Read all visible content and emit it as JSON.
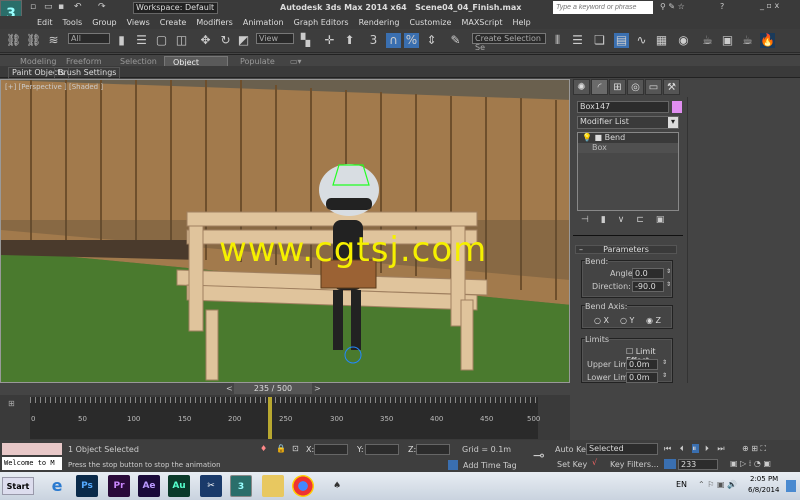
{
  "title_bar": {
    "workspace": "Workspace: Default",
    "app_title": "Autodesk 3ds Max  2014 x64",
    "file_name": "Scene04_04_Finish.max",
    "search_placeholder": "Type a keyword or phrase"
  },
  "menu": [
    "Edit",
    "Tools",
    "Group",
    "Views",
    "Create",
    "Modifiers",
    "Animation",
    "Graph Editors",
    "Rendering",
    "Customize",
    "MAXScript",
    "Help"
  ],
  "toolbar": {
    "selection_filter": "All",
    "ref_coord": "View",
    "snap_label": "3",
    "selection_set": "Create Selection Se"
  },
  "ribbon": {
    "tabs": [
      "Modeling",
      "Freeform",
      "Selection",
      "Object Paint",
      "Populate"
    ],
    "active_tab": "Object Paint",
    "sub_buttons": [
      "Paint Objects",
      "Brush Settings"
    ]
  },
  "viewport": {
    "label": "[+] [Perspective ] [Shaded ]",
    "watermark": "www.cgtsj.com"
  },
  "command_panel": {
    "object_name": "Box147",
    "object_color": "#e08ef0",
    "modifier_list": "Modifier List",
    "stack": [
      "Bend",
      "Box"
    ],
    "rollout_title": "Parameters",
    "bend_group": "Bend:",
    "angle_label": "Angle:",
    "angle": "0.0",
    "direction_label": "Direction:",
    "direction": "-90.0",
    "axis_group": "Bend Axis:",
    "axes": [
      "X",
      "Y",
      "Z"
    ],
    "selected_axis": "Z",
    "limits_group": "Limits",
    "limit_effect": "Limit Effect",
    "limit_effect_checked": false,
    "upper_label": "Upper Limit:",
    "upper": "0.0m",
    "lower_label": "Lower Limit:",
    "lower": "0.0m"
  },
  "timeline": {
    "frame_display": "235 / 500",
    "current_frame": 235,
    "ticks": [
      "0",
      "50",
      "100",
      "150",
      "200",
      "250",
      "300",
      "350",
      "400",
      "450",
      "500"
    ]
  },
  "status": {
    "maxscript": "Welcome to M",
    "selection": "1 Object Selected",
    "prompt": "Press the stop button to stop the animation",
    "x_label": "X:",
    "y_label": "Y:",
    "z_label": "Z:",
    "grid": "Grid = 0.1m",
    "add_time_tag": "Add Time Tag",
    "auto_key": "Auto Key",
    "set_key": "Set Key",
    "key_mode": "Selected",
    "key_filters": "Key Filters...",
    "frame": "233"
  },
  "taskbar": {
    "start": "Start",
    "apps": [
      "Ps",
      "Pr",
      "Ae",
      "Au"
    ],
    "lang": "EN",
    "time": "2:05 PM",
    "date": "6/8/2014"
  }
}
